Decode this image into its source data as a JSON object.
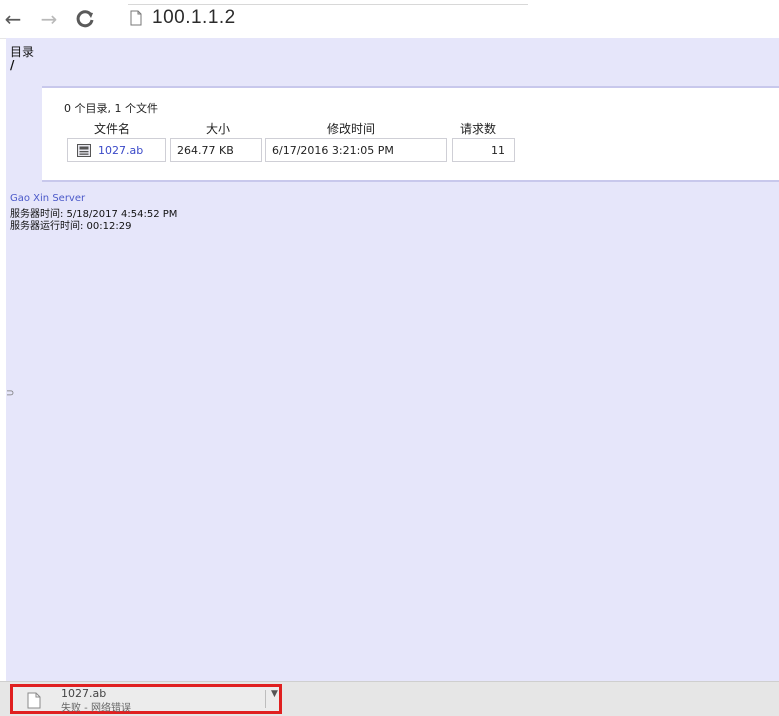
{
  "browser": {
    "back_icon": "back-arrow-icon",
    "forward_icon": "forward-arrow-icon",
    "reload_icon": "reload-icon",
    "page_icon": "page-icon",
    "url": "100.1.1.2"
  },
  "page": {
    "background": "#e6e6fa",
    "directory_label": "目录",
    "directory_path": "/",
    "summary": "0 个目录, 1 个文件",
    "columns": [
      "文件名",
      "大小",
      "修改时间",
      "请求数"
    ],
    "files": [
      {
        "name": "1027.ab",
        "size": "264.77 KB",
        "modified": "6/17/2016 3:21:05 PM",
        "requests": "11"
      }
    ],
    "server_name": "Gao Xin Server",
    "server_time": "服务器时间: 5/18/2017 4:54:52 PM",
    "server_uptime": "服务器运行时间: 00:12:29"
  },
  "download_bar": {
    "file_name": "1027.ab",
    "status": "失败 - 网络错误",
    "highlight_color": "#e02020"
  }
}
